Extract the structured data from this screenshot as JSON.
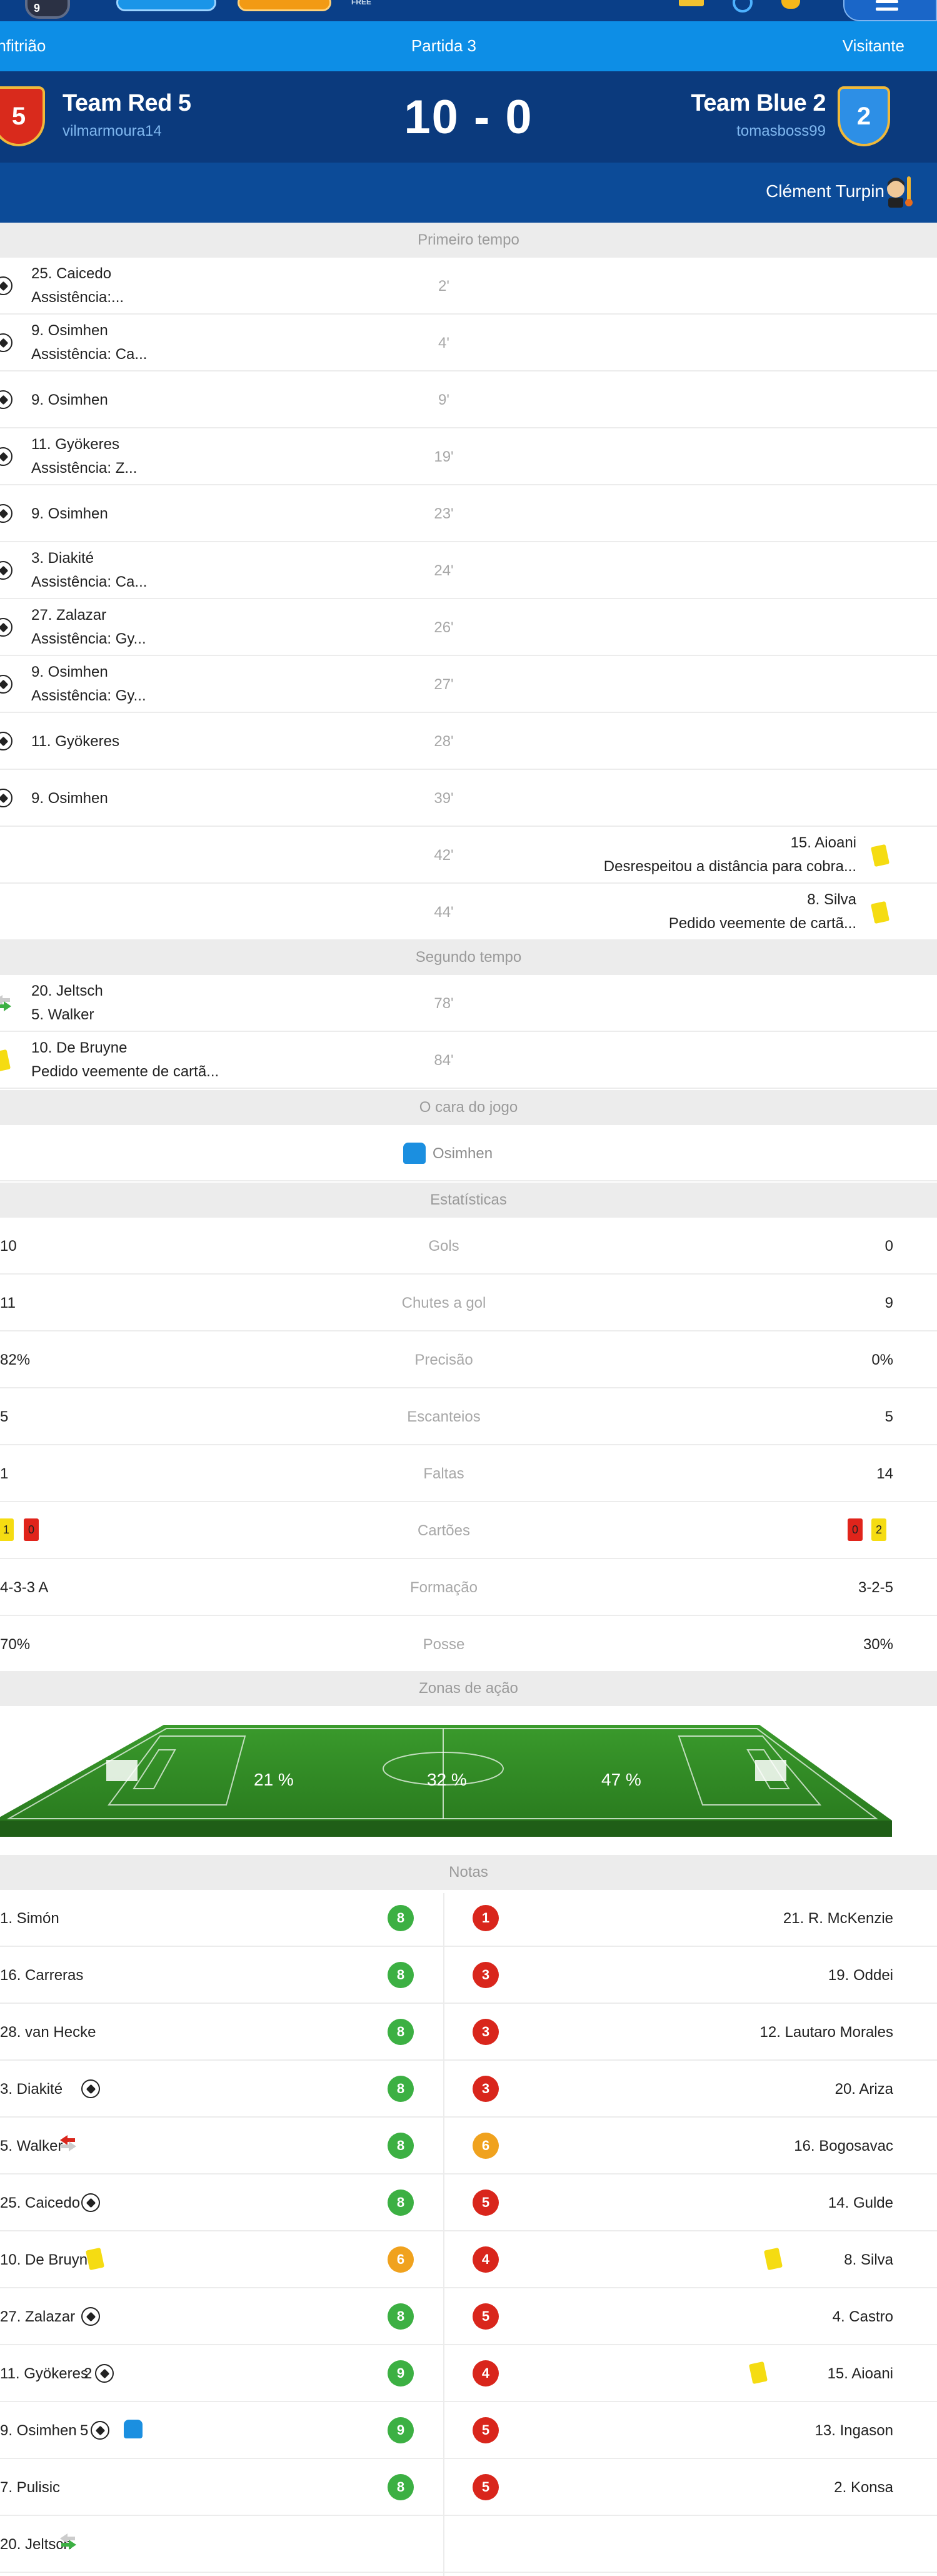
{
  "header": {
    "home_label": "Anfitrião",
    "match_label": "Partida 3",
    "away_label": "Visitante",
    "home_team": "Team Red 5",
    "home_badge": "5",
    "home_user": "vilmarmoura14",
    "score": "10 - 0",
    "away_team": "Team Blue 2",
    "away_badge": "2",
    "away_user": "tomasboss99",
    "referee": "Clément Turpin"
  },
  "topbar": {
    "avatar_badge": "9",
    "free_tag": "FREE"
  },
  "first_half": {
    "title": "Primeiro tempo",
    "events": [
      {
        "minute": "2'",
        "side": "home",
        "icon": "ball-icon",
        "line1": "25. Caicedo",
        "line2": "Assistência:..."
      },
      {
        "minute": "4'",
        "side": "home",
        "icon": "ball-icon",
        "line1": "9. Osimhen",
        "line2": "Assistência: Ca..."
      },
      {
        "minute": "9'",
        "side": "home",
        "icon": "ball-icon",
        "line1": "9. Osimhen",
        "line2": ""
      },
      {
        "minute": "19'",
        "side": "home",
        "icon": "ball-icon",
        "line1": "11. Gyökeres",
        "line2": "Assistência: Z..."
      },
      {
        "minute": "23'",
        "side": "home",
        "icon": "ball-icon",
        "line1": "9. Osimhen",
        "line2": ""
      },
      {
        "minute": "24'",
        "side": "home",
        "icon": "ball-icon",
        "line1": "3. Diakité",
        "line2": "Assistência: Ca..."
      },
      {
        "minute": "26'",
        "side": "home",
        "icon": "ball-icon",
        "line1": "27. Zalazar",
        "line2": "Assistência: Gy..."
      },
      {
        "minute": "27'",
        "side": "home",
        "icon": "ball-icon",
        "line1": "9. Osimhen",
        "line2": "Assistência: Gy..."
      },
      {
        "minute": "28'",
        "side": "home",
        "icon": "ball-icon",
        "line1": "11. Gyökeres",
        "line2": ""
      },
      {
        "minute": "39'",
        "side": "home",
        "icon": "ball-icon",
        "line1": "9. Osimhen",
        "line2": ""
      },
      {
        "minute": "42'",
        "side": "away",
        "icon": "yellow-card-icon",
        "line1": "15. Aioani",
        "line2": "Desrespeitou a distância para cobra..."
      },
      {
        "minute": "44'",
        "side": "away",
        "icon": "yellow-card-icon",
        "line1": "8. Silva",
        "line2": "Pedido veemente de cartã..."
      }
    ]
  },
  "second_half": {
    "title": "Segundo tempo",
    "events": [
      {
        "minute": "78'",
        "side": "home",
        "icon": "substitution-icon",
        "line1": "20. Jeltsch",
        "line2": "5. Walker"
      },
      {
        "minute": "84'",
        "side": "home",
        "icon": "yellow-card-icon",
        "line1": "10. De Bruyne",
        "line2": "Pedido veemente de cartã..."
      }
    ]
  },
  "man_of_match": {
    "title": "O cara do jogo",
    "player": "Osimhen"
  },
  "statistics": {
    "title": "Estatísticas",
    "rows": [
      {
        "label": "Gols",
        "home": "10",
        "away": "0"
      },
      {
        "label": "Chutes a gol",
        "home": "11",
        "away": "9"
      },
      {
        "label": "Precisão",
        "home": "82%",
        "away": "0%"
      },
      {
        "label": "Escanteios",
        "home": "5",
        "away": "5"
      },
      {
        "label": "Faltas",
        "home": "1",
        "away": "14"
      },
      {
        "label": "Cartões",
        "home": "",
        "away": ""
      },
      {
        "label": "Formação",
        "home": "4-3-3 A",
        "away": "3-2-5"
      },
      {
        "label": "Posse",
        "home": "70%",
        "away": "30%"
      }
    ],
    "cards": {
      "home_yellow": "1",
      "home_red": "0",
      "away_red": "0",
      "away_yellow": "2"
    }
  },
  "action_zones": {
    "title": "Zonas de ação",
    "left": "21 %",
    "center": "32 %",
    "right": "47 %"
  },
  "ratings": {
    "title": "Notas",
    "home": [
      {
        "player": "1. Simón",
        "rating": "8",
        "color": "#3cb043",
        "extra": ""
      },
      {
        "player": "16. Carreras",
        "rating": "8",
        "color": "#3cb043",
        "extra": ""
      },
      {
        "player": "28. van Hecke",
        "rating": "8",
        "color": "#3cb043",
        "extra": ""
      },
      {
        "player": "3. Diakité",
        "rating": "8",
        "color": "#3cb043",
        "extra": "ball"
      },
      {
        "player": "5. Walker",
        "rating": "8",
        "color": "#3cb043",
        "extra": "sub-out"
      },
      {
        "player": "25. Caicedo",
        "rating": "8",
        "color": "#3cb043",
        "extra": "ball"
      },
      {
        "player": "10. De Bruyne",
        "rating": "6",
        "color": "#f0a21e",
        "extra": "yellow"
      },
      {
        "player": "27. Zalazar",
        "rating": "8",
        "color": "#3cb043",
        "extra": "ball"
      },
      {
        "player": "11. Gyökeres",
        "rating": "9",
        "color": "#3cb043",
        "extra": "ball2"
      },
      {
        "player": "9. Osimhen",
        "rating": "9",
        "color": "#3cb043",
        "extra": "ball5"
      },
      {
        "player": "7. Pulisic",
        "rating": "8",
        "color": "#3cb043",
        "extra": ""
      },
      {
        "player": "20. Jeltsch",
        "rating": "",
        "color": "",
        "extra": "sub-in"
      }
    ],
    "away": [
      {
        "player": "21. R. McKenzie",
        "rating": "1",
        "color": "#d9261c",
        "extra": ""
      },
      {
        "player": "19. Oddei",
        "rating": "3",
        "color": "#d9261c",
        "extra": ""
      },
      {
        "player": "12. Lautaro Morales",
        "rating": "3",
        "color": "#d9261c",
        "extra": ""
      },
      {
        "player": "20. Ariza",
        "rating": "3",
        "color": "#d9261c",
        "extra": ""
      },
      {
        "player": "16. Bogosavac",
        "rating": "6",
        "color": "#f0a21e",
        "extra": ""
      },
      {
        "player": "14. Gulde",
        "rating": "5",
        "color": "#d9261c",
        "extra": ""
      },
      {
        "player": "8. Silva",
        "rating": "4",
        "color": "#d9261c",
        "extra": "yellow"
      },
      {
        "player": "4. Castro",
        "rating": "5",
        "color": "#d9261c",
        "extra": ""
      },
      {
        "player": "15. Aioani",
        "rating": "4",
        "color": "#d9261c",
        "extra": "yellow"
      },
      {
        "player": "13. Ingason",
        "rating": "5",
        "color": "#d9261c",
        "extra": ""
      },
      {
        "player": "2. Konsa",
        "rating": "5",
        "color": "#d9261c",
        "extra": ""
      }
    ],
    "osimhen_goals": "5",
    "gyokeres_goals": "2"
  },
  "colors": {
    "header_blue": "#0d8ee6",
    "navy": "#0b3a7d",
    "rating_green": "#3cb043",
    "rating_orange": "#f0a21e",
    "rating_red": "#d9261c"
  }
}
